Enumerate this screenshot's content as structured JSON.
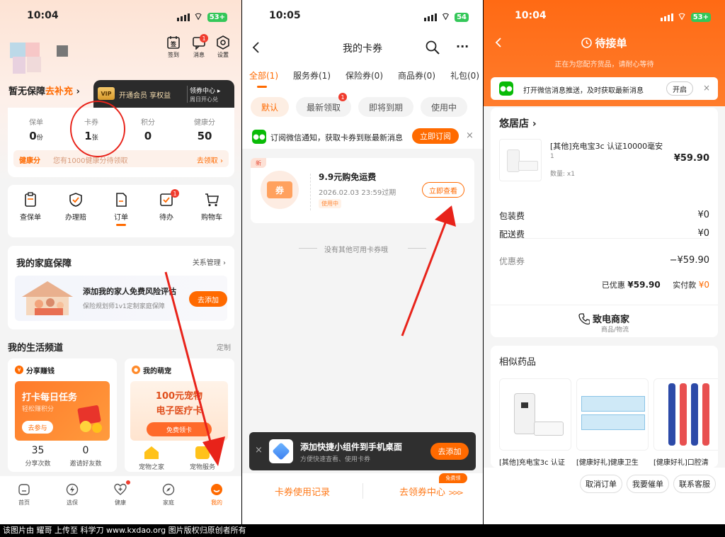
{
  "p1": {
    "time": "10:04",
    "battery": "53+",
    "header_icons": [
      {
        "label": "签到",
        "icon": "calendar-sign-icon"
      },
      {
        "label": "消息",
        "icon": "message-icon",
        "badge": "1"
      },
      {
        "label": "设置",
        "icon": "settings-icon"
      }
    ],
    "guarantee": {
      "prefix": "暂无保障",
      "action": "去补充"
    },
    "vip": {
      "badge": "VIP",
      "text": "开通会员 享权益"
    },
    "coupon_center": {
      "title": "领券中心",
      "sub": "周日开心兑"
    },
    "stats": [
      {
        "label": "保单",
        "value": "0",
        "unit": "份"
      },
      {
        "label": "卡券",
        "value": "1",
        "unit": "张"
      },
      {
        "label": "积分",
        "value": "0",
        "unit": ""
      },
      {
        "label": "健康分",
        "value": "50",
        "unit": ""
      }
    ],
    "health": {
      "tag": "健康分",
      "text": "您有1000健康分待领取",
      "action": "去领取"
    },
    "quick": [
      {
        "label": "查保单",
        "icon": "clipboard-icon"
      },
      {
        "label": "办理赔",
        "icon": "shield-check-icon"
      },
      {
        "label": "订单",
        "icon": "document-icon"
      },
      {
        "label": "待办",
        "icon": "checklist-icon",
        "badge": "1"
      },
      {
        "label": "购物车",
        "icon": "cart-icon"
      }
    ],
    "family": {
      "title": "我的家庭保障",
      "link": "关系管理",
      "text": "添加我的家人免费风险评估",
      "sub": "保险规划师1v1定制家庭保障",
      "button": "去添加"
    },
    "life": {
      "title": "我的生活频道",
      "link": "定制"
    },
    "share": {
      "title": "分享赚钱",
      "banner": "打卡每日任务",
      "banner_sub": "轻松赚积分",
      "button": "去参与",
      "stats": [
        {
          "value": "35",
          "label": "分享次数"
        },
        {
          "value": "0",
          "label": "邀请好友数"
        }
      ]
    },
    "pet": {
      "title": "我的萌宠",
      "banner": "100元宠物",
      "banner2": "电子医疗卡",
      "button": "免费领卡",
      "items": [
        {
          "label": "宠物之家"
        },
        {
          "label": "宠物服务"
        }
      ]
    },
    "nav": [
      {
        "label": "首页",
        "icon": "home-icon"
      },
      {
        "label": "选保",
        "icon": "lightning-icon"
      },
      {
        "label": "健康",
        "icon": "heart-plus-icon"
      },
      {
        "label": "家庭",
        "icon": "compass-icon"
      },
      {
        "label": "我的",
        "icon": "user-active-icon"
      }
    ]
  },
  "p2": {
    "time": "10:05",
    "battery": "54",
    "title": "我的卡券",
    "tabs": [
      "全部(1)",
      "服务券(1)",
      "保险券(0)",
      "商品券(0)",
      "礼包(0)"
    ],
    "filters": [
      {
        "label": "默认"
      },
      {
        "label": "最新领取",
        "badge": "1"
      },
      {
        "label": "即将到期"
      },
      {
        "label": "使用中"
      }
    ],
    "notify": {
      "text": "订阅微信通知，获取卡券到账最新消息",
      "button": "立即订阅"
    },
    "coupon": {
      "new": "新",
      "icon": "券",
      "title": "9.9元购免运费",
      "expire": "2026.02.03 23:59过期",
      "status": "使用中",
      "button": "立即查看"
    },
    "empty": "没有其他可用卡券哦",
    "widget": {
      "title": "添加快捷小组件到手机桌面",
      "sub": "方便快速查看、使用卡券",
      "button": "去添加"
    },
    "bottom": {
      "left": "卡券使用记录",
      "right": "去领券中心",
      "tag": "免费领"
    }
  },
  "p3": {
    "time": "10:04",
    "battery": "53+",
    "title": "待接单",
    "subtitle": "正在为您配齐货品，请耐心等待",
    "notify": {
      "text": "打开微信消息推送，及时获取最新消息",
      "button": "开启"
    },
    "shop": "悠居店",
    "product": {
      "name": "[其他]充电宝3c 认证10000毫安",
      "qty": "1",
      "count_label": "数量: x1",
      "price": "¥59.90"
    },
    "fees": [
      {
        "label": "包装费",
        "value": "¥0"
      },
      {
        "label": "配送费",
        "value": "¥0"
      }
    ],
    "discount": {
      "label": "优惠券",
      "value": "−¥59.90"
    },
    "summary": {
      "saved_label": "已优惠",
      "saved": "¥59.90",
      "paid_label": "实付款",
      "paid": "¥0"
    },
    "call": {
      "title": "致电商家",
      "sub": "商品/物流"
    },
    "similar": {
      "title": "相似药品",
      "items": [
        "[其他]充电宝3c 认证",
        "[健康好礼]健康卫生",
        "[健康好礼]口腔清"
      ]
    },
    "actions": [
      "取消订单",
      "我要催单",
      "联系客服"
    ]
  },
  "watermark": "该图片由 耀哥 上传至 科学刀 www.kxdao.org 图片版权归原创者所有",
  "colors": {
    "accent": "#ff6a00",
    "accent2": "#ff7a1a",
    "wechat": "#09bb07",
    "annotation": "#e8231a"
  }
}
